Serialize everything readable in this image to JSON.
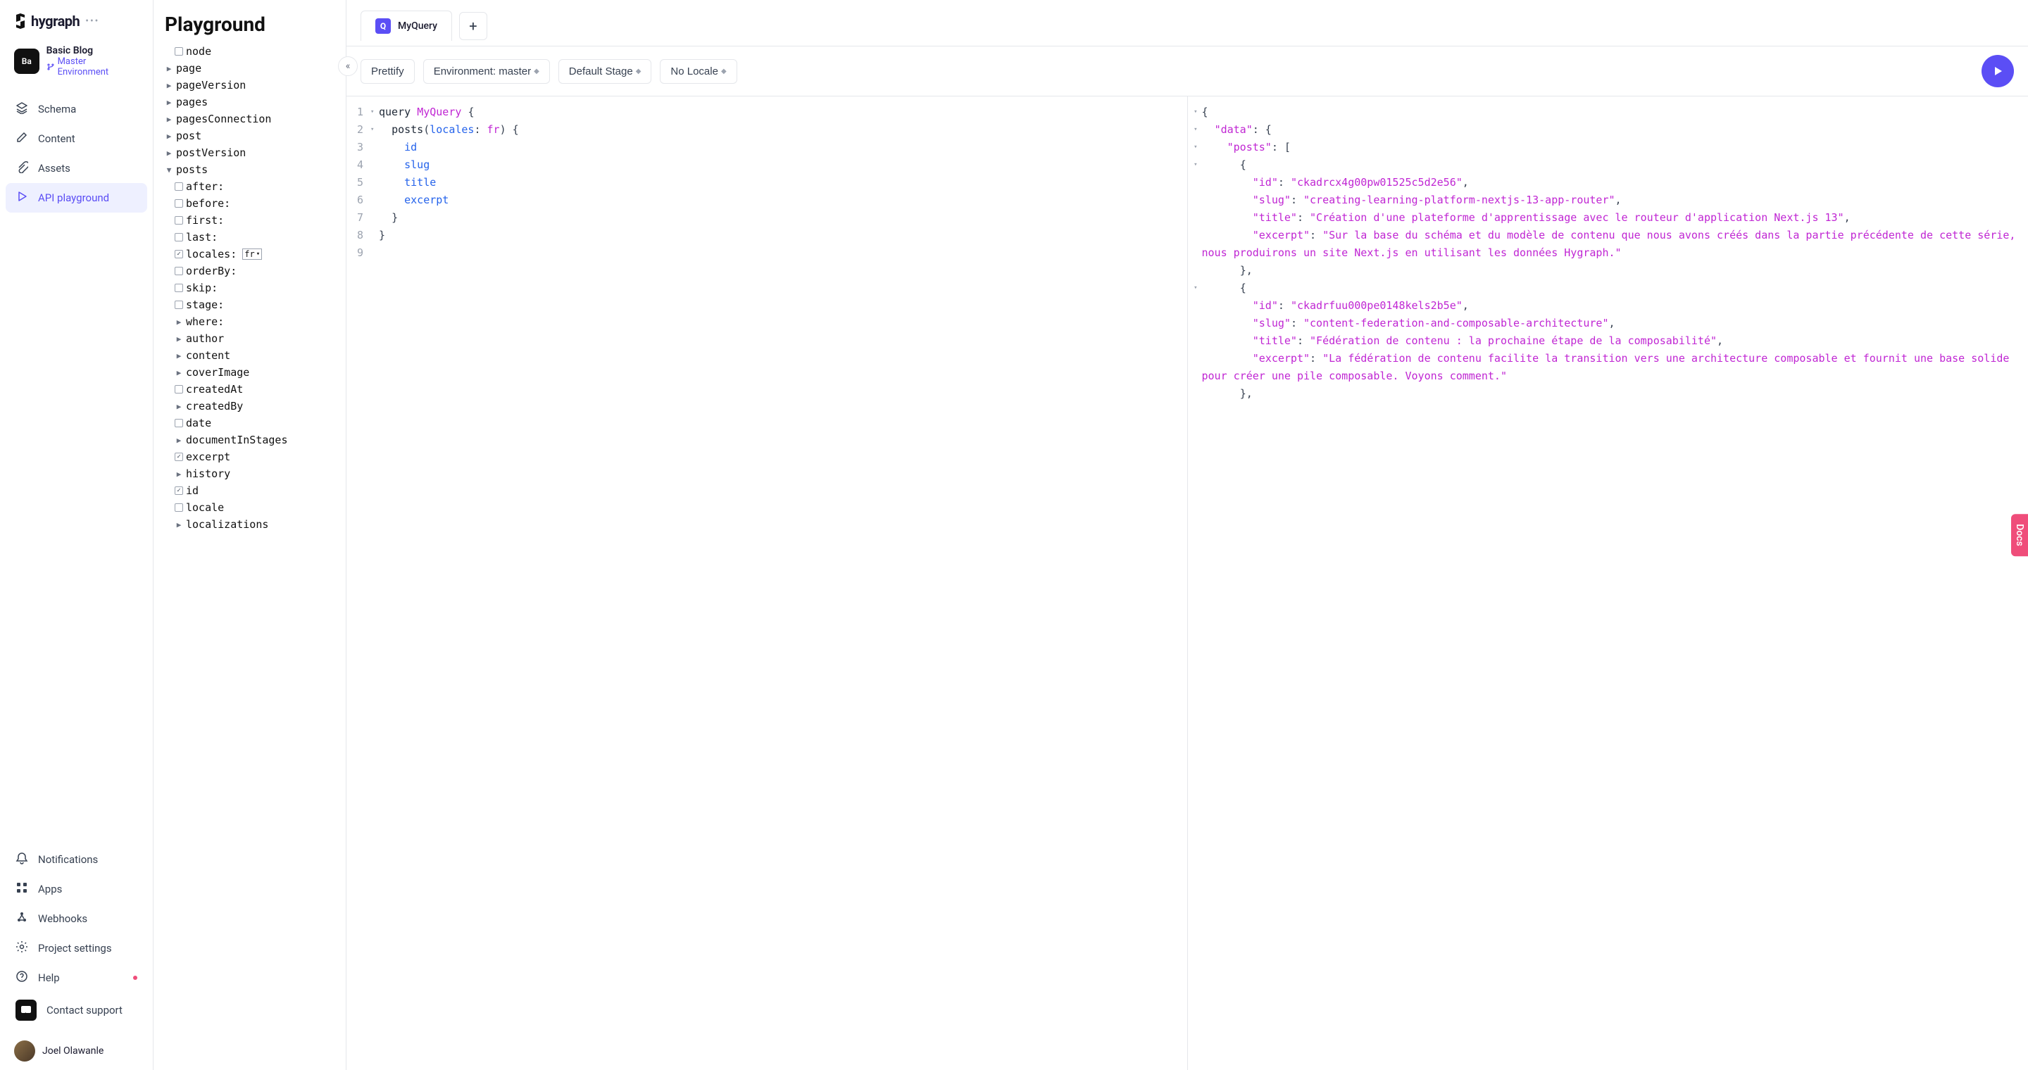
{
  "brand": "hygraph",
  "project": {
    "badge": "Ba",
    "name": "Basic Blog",
    "env": "Master Environment"
  },
  "nav": [
    {
      "label": "Schema",
      "icon": "layers"
    },
    {
      "label": "Content",
      "icon": "pencil"
    },
    {
      "label": "Assets",
      "icon": "paperclip"
    },
    {
      "label": "API playground",
      "icon": "play-outline",
      "active": true
    }
  ],
  "nav_bottom": [
    {
      "label": "Notifications",
      "icon": "bell"
    },
    {
      "label": "Apps",
      "icon": "grid"
    },
    {
      "label": "Webhooks",
      "icon": "webhook"
    },
    {
      "label": "Project settings",
      "icon": "gear"
    },
    {
      "label": "Help",
      "icon": "help",
      "dot": true
    },
    {
      "label": "Contact support",
      "icon": "chat",
      "boxed": true
    }
  ],
  "user": {
    "name": "Joel Olawanle"
  },
  "explorer": {
    "title": "Playground",
    "items": [
      {
        "label": "node",
        "kind": "check",
        "depth": 1
      },
      {
        "label": "page",
        "kind": "caret"
      },
      {
        "label": "pageVersion",
        "kind": "caret"
      },
      {
        "label": "pages",
        "kind": "caret"
      },
      {
        "label": "pagesConnection",
        "kind": "caret"
      },
      {
        "label": "post",
        "kind": "caret"
      },
      {
        "label": "postVersion",
        "kind": "caret"
      },
      {
        "label": "posts",
        "kind": "caret",
        "open": true
      },
      {
        "label": "after:",
        "kind": "check",
        "depth": 1
      },
      {
        "label": "before:",
        "kind": "check",
        "depth": 1
      },
      {
        "label": "first:",
        "kind": "check",
        "depth": 1
      },
      {
        "label": "last:",
        "kind": "check",
        "depth": 1
      },
      {
        "label": "locales:",
        "kind": "check",
        "depth": 1,
        "checked": true,
        "select": "fr"
      },
      {
        "label": "orderBy:",
        "kind": "check",
        "depth": 1
      },
      {
        "label": "skip:",
        "kind": "check",
        "depth": 1
      },
      {
        "label": "stage:",
        "kind": "check",
        "depth": 1
      },
      {
        "label": "where:",
        "kind": "caret",
        "depth": 1
      },
      {
        "label": "author",
        "kind": "caret",
        "depth": 1
      },
      {
        "label": "content",
        "kind": "caret",
        "depth": 1
      },
      {
        "label": "coverImage",
        "kind": "caret",
        "depth": 1
      },
      {
        "label": "createdAt",
        "kind": "check",
        "depth": 1
      },
      {
        "label": "createdBy",
        "kind": "caret",
        "depth": 1
      },
      {
        "label": "date",
        "kind": "check",
        "depth": 1
      },
      {
        "label": "documentInStages",
        "kind": "caret",
        "depth": 1
      },
      {
        "label": "excerpt",
        "kind": "check",
        "depth": 1,
        "checked": true
      },
      {
        "label": "history",
        "kind": "caret",
        "depth": 1
      },
      {
        "label": "id",
        "kind": "check",
        "depth": 1,
        "checked": true
      },
      {
        "label": "locale",
        "kind": "check",
        "depth": 1
      },
      {
        "label": "localizations",
        "kind": "caret",
        "depth": 1
      }
    ]
  },
  "tabs": {
    "q_label": "Q",
    "query_name": "MyQuery"
  },
  "toolbar": {
    "prettify": "Prettify",
    "env": "Environment: master",
    "stage": "Default Stage",
    "locale": "No Locale"
  },
  "code": [
    {
      "n": "1",
      "fold": "▾",
      "html": "<span class='fn'>query</span> <span class='id'>MyQuery</span> <span class='punc'>{</span>"
    },
    {
      "n": "2",
      "fold": "▾",
      "html": "  <span class='fn'>posts</span><span class='punc'>(</span><span class='arg'>locales</span><span class='punc'>:</span> <span class='val'>fr</span><span class='punc'>) {</span>"
    },
    {
      "n": "3",
      "fold": "",
      "html": "    <span class='field'>id</span>"
    },
    {
      "n": "4",
      "fold": "",
      "html": "    <span class='field'>slug</span>"
    },
    {
      "n": "5",
      "fold": "",
      "html": "    <span class='field'>title</span>"
    },
    {
      "n": "6",
      "fold": "",
      "html": "    <span class='field'>excerpt</span>"
    },
    {
      "n": "7",
      "fold": "",
      "html": "  <span class='punc'>}</span>"
    },
    {
      "n": "8",
      "fold": "",
      "html": "<span class='punc'>}</span>"
    },
    {
      "n": "9",
      "fold": "",
      "html": ""
    }
  ],
  "result": [
    {
      "f": "▾",
      "html": "<span class='punc'>{</span>"
    },
    {
      "f": "▾",
      "html": "  <span class='key'>\"data\"</span><span class='punc'>: {</span>"
    },
    {
      "f": "▾",
      "html": "    <span class='key'>\"posts\"</span><span class='punc'>: [</span>"
    },
    {
      "f": "▾",
      "html": "      <span class='punc'>{</span>"
    },
    {
      "f": "",
      "html": "        <span class='key'>\"id\"</span><span class='punc'>: </span><span class='str'>\"ckadrcx4g00pw01525c5d2e56\"</span><span class='punc'>,</span>"
    },
    {
      "f": "",
      "html": "        <span class='key'>\"slug\"</span><span class='punc'>: </span><span class='str'>\"creating-learning-platform-nextjs-13-app-router\"</span><span class='punc'>,</span>"
    },
    {
      "f": "",
      "html": "        <span class='key'>\"title\"</span><span class='punc'>: </span><span class='str'>\"Création d'une plateforme d'apprentissage avec le routeur d'application Next.js 13\"</span><span class='punc'>,</span>"
    },
    {
      "f": "",
      "html": "        <span class='key'>\"excerpt\"</span><span class='punc'>: </span><span class='str'>\"Sur la base du schéma et du modèle de contenu que nous avons créés dans la partie précédente de cette série, nous produirons un site Next.js en utilisant les données Hygraph.\"</span>"
    },
    {
      "f": "",
      "html": "      <span class='punc'>},</span>"
    },
    {
      "f": "▾",
      "html": "      <span class='punc'>{</span>"
    },
    {
      "f": "",
      "html": "        <span class='key'>\"id\"</span><span class='punc'>: </span><span class='str'>\"ckadrfuu000pe0148kels2b5e\"</span><span class='punc'>,</span>"
    },
    {
      "f": "",
      "html": "        <span class='key'>\"slug\"</span><span class='punc'>: </span><span class='str'>\"content-federation-and-composable-architecture\"</span><span class='punc'>,</span>"
    },
    {
      "f": "",
      "html": "        <span class='key'>\"title\"</span><span class='punc'>: </span><span class='str'>\"Fédération de contenu : la prochaine étape de la composabilité\"</span><span class='punc'>,</span>"
    },
    {
      "f": "",
      "html": "        <span class='key'>\"excerpt\"</span><span class='punc'>: </span><span class='str'>\"La fédération de contenu facilite la transition vers une architecture composable et fournit une base solide pour créer une pile composable. Voyons comment.\"</span>"
    },
    {
      "f": "",
      "html": "      <span class='punc'>},</span>"
    }
  ],
  "docs_tab": "Docs"
}
